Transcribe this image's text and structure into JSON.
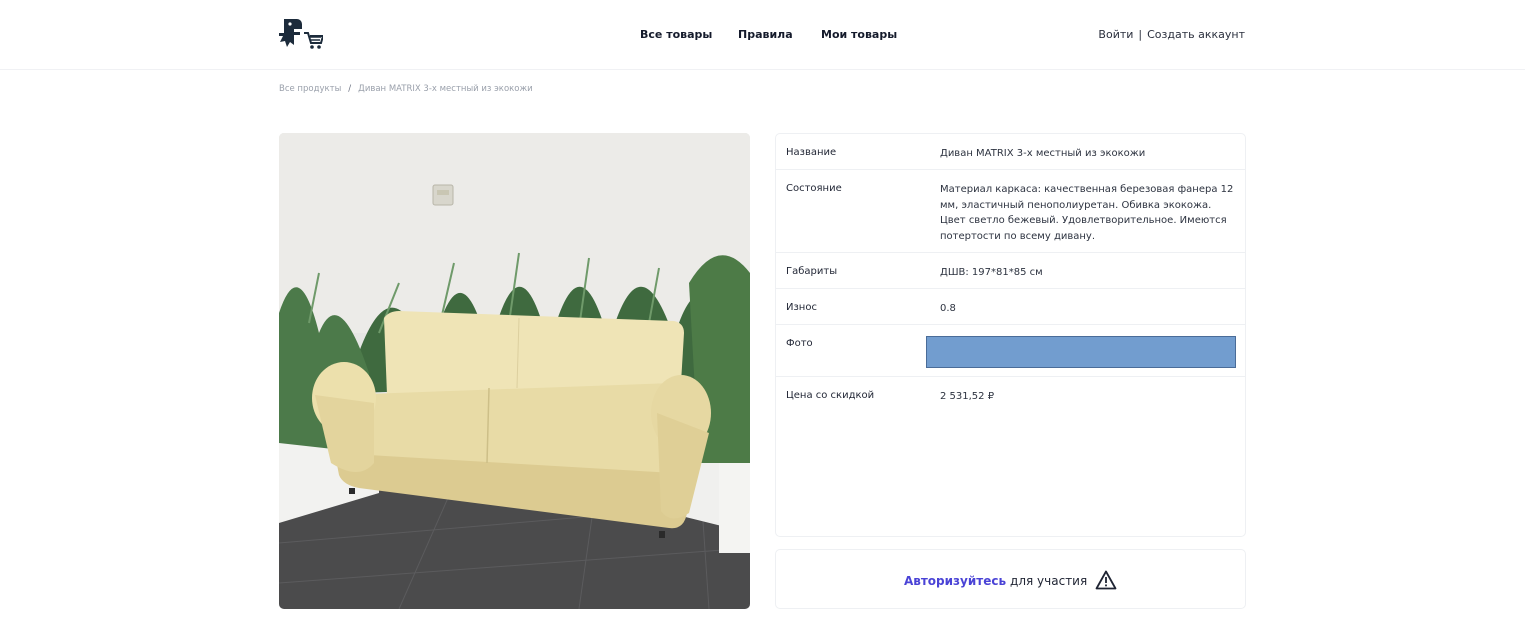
{
  "header": {
    "logo_icon": "dino-cart-logo-icon",
    "nav": {
      "all_products": "Все товары",
      "rules": "Правила",
      "my_products": "Мои товары"
    },
    "auth": {
      "login": "Войти",
      "separator": "|",
      "register": "Создать аккаунт"
    }
  },
  "breadcrumb": {
    "root": "Все продукты",
    "separator": "/",
    "current": "Диван MATRIX 3-х местный из экокожи"
  },
  "product": {
    "image_icon": "sofa-photo",
    "rows": [
      {
        "label": "Название",
        "value": "Диван MATRIX 3-х местный из экокожи"
      },
      {
        "label": "Состояние",
        "value": "Материал каркаса: качественная березовая фанера 12 мм, эластичный пенополиуретан. Обивка экокожа. Цвет светло бежевый. Удовлетворительное. Имеются потертости по всему дивану."
      },
      {
        "label": "Габариты",
        "value": "ДШВ: 197*81*85 см"
      },
      {
        "label": "Износ",
        "value": "0.8"
      },
      {
        "label": "Фото",
        "value": ""
      },
      {
        "label": "Цена со скидкой",
        "value": "2 531,52 ₽"
      }
    ],
    "photo_block_color": "#729dcf"
  },
  "notice": {
    "login_link": "Авторизуйтесь",
    "text": "для участия",
    "icon": "warning-icon"
  },
  "colors": {
    "accent": "#4a43d6",
    "logo": "#1c2b3b"
  }
}
